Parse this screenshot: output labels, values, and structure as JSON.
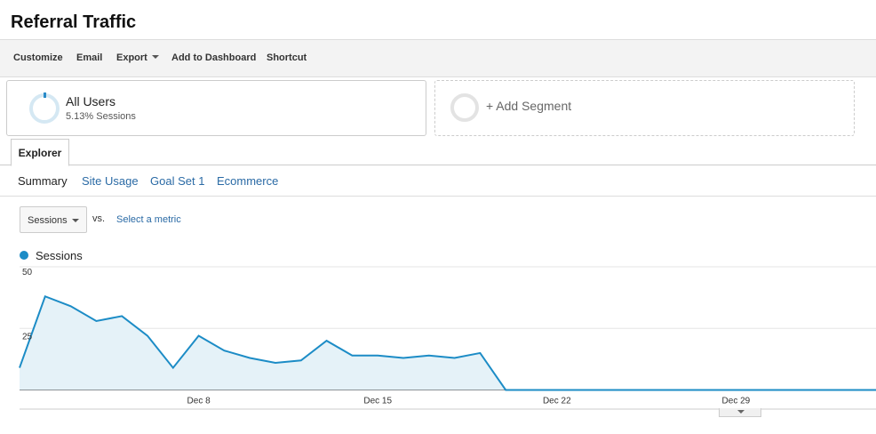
{
  "page": {
    "title": "Referral Traffic"
  },
  "toolbar": {
    "items": [
      "Customize",
      "Email",
      "Export",
      "Add to Dashboard",
      "Shortcut"
    ]
  },
  "segments": {
    "active": {
      "name": "All Users",
      "detail": "5.13% Sessions"
    },
    "add_label": "+ Add Segment"
  },
  "tabs": {
    "main": "Explorer",
    "sub": [
      "Summary",
      "Site Usage",
      "Goal Set 1",
      "Ecommerce"
    ]
  },
  "metric": {
    "selected": "Sessions",
    "vs": "vs.",
    "select_link": "Select a metric"
  },
  "colors": {
    "series": "#1c8cc6",
    "fill": "#e5f2f8",
    "link": "#2a6aa5"
  },
  "chart_data": {
    "type": "area",
    "x": [
      "Dec 1",
      "Dec 2",
      "Dec 3",
      "Dec 4",
      "Dec 5",
      "Dec 6",
      "Dec 7",
      "Dec 8",
      "Dec 9",
      "Dec 10",
      "Dec 11",
      "Dec 12",
      "Dec 13",
      "Dec 14",
      "Dec 15",
      "Dec 16",
      "Dec 17",
      "Dec 18",
      "Dec 19",
      "Dec 20",
      "Dec 21",
      "Dec 22",
      "Dec 23",
      "Dec 24",
      "Dec 25",
      "Dec 26",
      "Dec 27",
      "Dec 28",
      "Dec 29",
      "Dec 30",
      "Dec 31",
      "Jan 1",
      "Jan 2",
      "Jan 3",
      "Jan 4"
    ],
    "series": [
      {
        "name": "Sessions",
        "values": [
          9,
          38,
          34,
          28,
          30,
          22,
          9,
          22,
          16,
          13,
          11,
          12,
          20,
          14,
          14,
          13,
          14,
          13,
          15,
          0,
          0,
          0,
          0,
          0,
          0,
          0,
          0,
          0,
          0,
          0,
          0,
          0,
          0,
          0,
          0
        ]
      }
    ],
    "xtick_labels": [
      "Dec 8",
      "Dec 15",
      "Dec 22",
      "Dec 29"
    ],
    "ytick_labels": [
      "50",
      "25"
    ],
    "ylim": [
      0,
      50
    ],
    "grid": true
  }
}
